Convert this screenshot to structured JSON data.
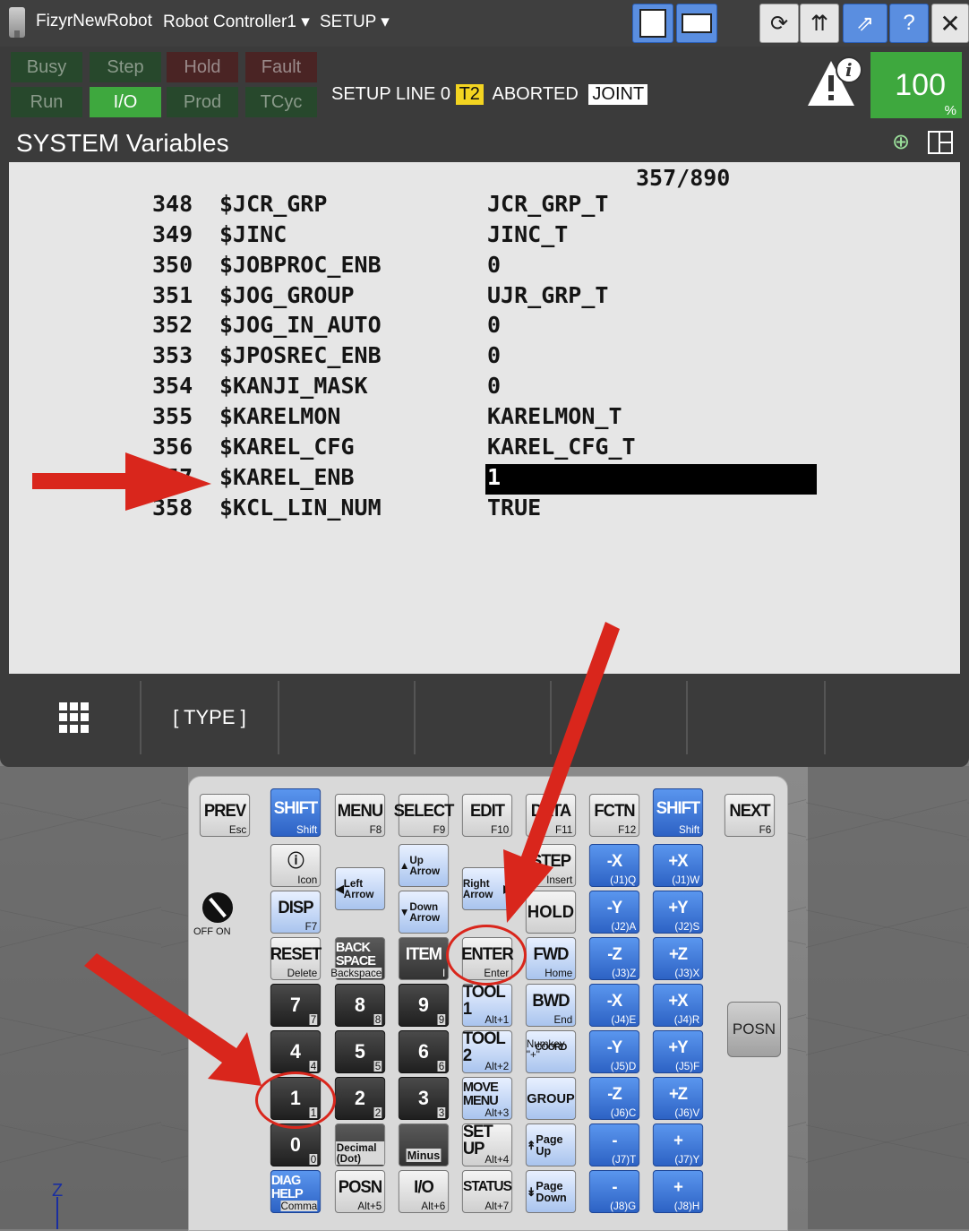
{
  "titlebar": {
    "robot_name": "FizyrNewRobot",
    "controller": "Robot Controller1",
    "menu": "SETUP"
  },
  "status": {
    "busy": "Busy",
    "step": "Step",
    "hold": "Hold",
    "fault": "Fault",
    "run": "Run",
    "io": "I/O",
    "prod": "Prod",
    "tcyc": "TCyc",
    "line_text": "SETUP LINE 0",
    "mode": "T2",
    "state": "ABORTED",
    "coord": "JOINT",
    "override_value": "100",
    "override_unit": "%"
  },
  "screen": {
    "title": "SYSTEM Variables",
    "counter": "357/890",
    "rows": [
      {
        "num": "348",
        "name": "$JCR_GRP",
        "value": "JCR_GRP_T"
      },
      {
        "num": "349",
        "name": "$JINC",
        "value": "JINC_T"
      },
      {
        "num": "350",
        "name": "$JOBPROC_ENB",
        "value": "0"
      },
      {
        "num": "351",
        "name": "$JOG_GROUP",
        "value": "UJR_GRP_T"
      },
      {
        "num": "352",
        "name": "$JOG_IN_AUTO",
        "value": "0"
      },
      {
        "num": "353",
        "name": "$JPOSREC_ENB",
        "value": "0"
      },
      {
        "num": "354",
        "name": "$KANJI_MASK",
        "value": "0"
      },
      {
        "num": "355",
        "name": "$KARELMON",
        "value": "KARELMON_T"
      },
      {
        "num": "356",
        "name": "$KAREL_CFG",
        "value": "KAREL_CFG_T"
      },
      {
        "num": "357",
        "name": "$KAREL_ENB",
        "value": "1"
      },
      {
        "num": "358",
        "name": "$KCL_LIN_NUM",
        "value": "TRUE"
      }
    ],
    "fkey_type": "[ TYPE ]"
  },
  "keypad": {
    "prev": "PREV",
    "prev_sub": "Esc",
    "shift": "SHIFT",
    "shift_sub": "Shift",
    "menu": "MENU",
    "menu_sub": "F8",
    "select": "SELECT",
    "select_sub": "F9",
    "edit": "EDIT",
    "edit_sub": "F10",
    "data": "DATA",
    "data_sub": "F11",
    "fctn": "FCTN",
    "fctn_sub": "F12",
    "next": "NEXT",
    "next_sub": "F6",
    "icon_sub": "Icon",
    "disp": "DISP",
    "disp_sub": "F7",
    "left_arrow": "Left Arrow",
    "up_arrow": "Up Arrow",
    "down_arrow": "Down Arrow",
    "right_arrow": "Right Arrow",
    "step": "STEP",
    "step_sub": "Insert",
    "hold": "HOLD",
    "reset": "RESET",
    "reset_sub": "Delete",
    "backspace": "BACK SPACE",
    "backspace_sub": "Backspace",
    "item": "ITEM",
    "item_sub": "I",
    "enter": "ENTER",
    "enter_sub": "Enter",
    "fwd": "FWD",
    "fwd_sub": "Home",
    "bwd": "BWD",
    "bwd_sub": "End",
    "tool1": "TOOL 1",
    "tool1_sub": "Alt+1",
    "tool2": "TOOL 2",
    "tool2_sub": "Alt+2",
    "coord": "COORD",
    "coord_sub": "Numkey \"+\"",
    "move_menu": "MOVE MENU",
    "move_menu_sub": "Alt+3",
    "group": "GROUP",
    "setup": "SET UP",
    "setup_sub": "Alt+4",
    "page_up": "Page Up",
    "page_down": "Page Down",
    "diag": "DIAG HELP",
    "diag_sub": "Comma",
    "posn": "POSN",
    "posn_sub": "Alt+5",
    "io": "I/O",
    "io_sub": "Alt+6",
    "status": "STATUS",
    "status_sub": "Alt+7",
    "decimal": "Decimal (Dot)",
    "minus": "Minus",
    "digits": [
      "7",
      "8",
      "9",
      "4",
      "5",
      "6",
      "1",
      "2",
      "3",
      "0"
    ],
    "digit_subs": [
      "7",
      "8",
      "9",
      "4",
      "5",
      "6",
      "1",
      "2",
      "3",
      "0"
    ],
    "jog": [
      {
        "m": "-X",
        "ms": "(J1)",
        "mk": "Q",
        "p": "+X",
        "ps": "(J1)",
        "pk": "W"
      },
      {
        "m": "-Y",
        "ms": "(J2)",
        "mk": "A",
        "p": "+Y",
        "ps": "(J2)",
        "pk": "S"
      },
      {
        "m": "-Z",
        "ms": "(J3)",
        "mk": "Z",
        "p": "+Z",
        "ps": "(J3)",
        "pk": "X"
      },
      {
        "m": "-X",
        "ms": "(J4)",
        "mk": "E",
        "p": "+X",
        "ps": "(J4)",
        "pk": "R"
      },
      {
        "m": "-Y",
        "ms": "(J5)",
        "mk": "D",
        "p": "+Y",
        "ps": "(J5)",
        "pk": "F"
      },
      {
        "m": "-Z",
        "ms": "(J6)",
        "mk": "C",
        "p": "+Z",
        "ps": "(J6)",
        "pk": "V"
      },
      {
        "m": "-",
        "ms": "(J7)",
        "mk": "T",
        "p": "+",
        "ps": "(J7)",
        "pk": "Y"
      },
      {
        "m": "-",
        "ms": "(J8)",
        "mk": "G",
        "p": "+",
        "ps": "(J8)",
        "pk": "H"
      }
    ],
    "posn_side": "POSN",
    "keyswitch": "OFF ON"
  },
  "axis": "Z",
  "colors": {
    "status_on": "#3ea83e",
    "mode_chip": "#f3d421",
    "selection": "#000000",
    "annotation": "#d9261c",
    "shift_blue": "#2d62c4"
  }
}
